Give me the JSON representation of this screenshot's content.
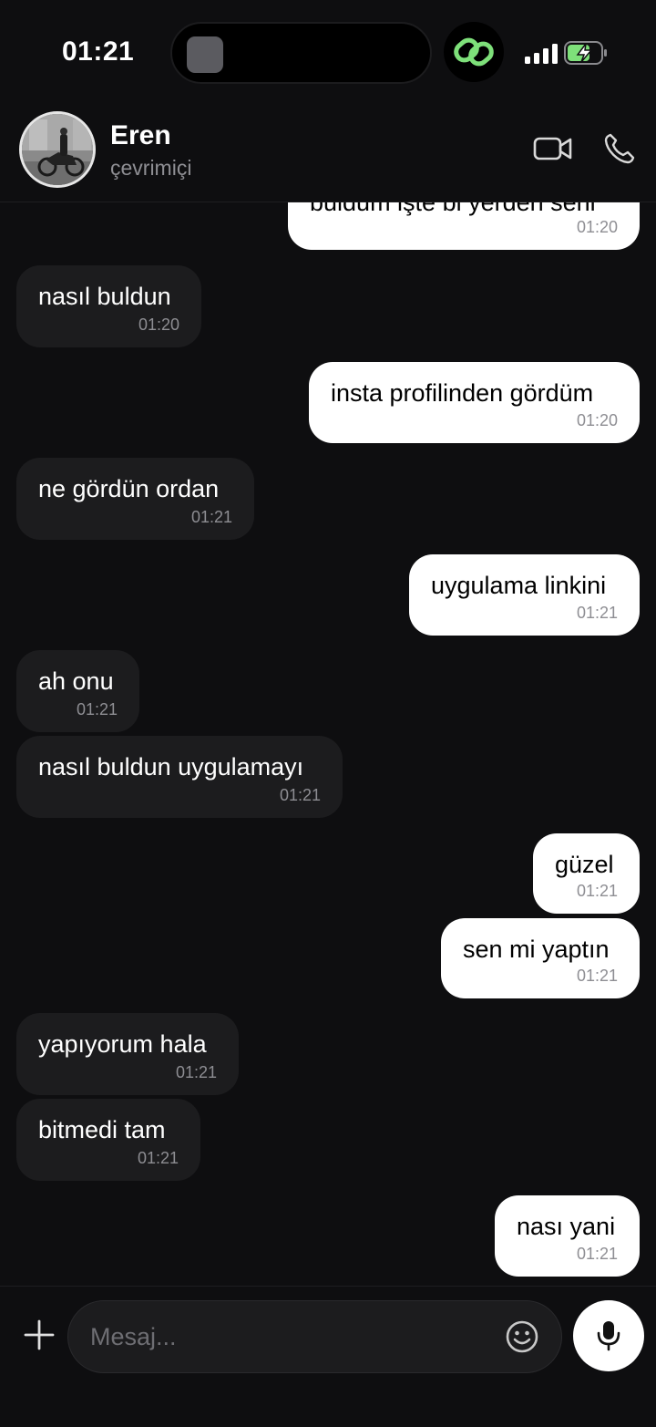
{
  "status_bar": {
    "time": "01:21"
  },
  "header": {
    "contact_name": "Eren",
    "contact_status": "çevrimiçi"
  },
  "messages": [
    {
      "dir": "out",
      "text": "buldum işte bi yerden seni",
      "time": "01:20"
    },
    {
      "dir": "in",
      "text": "nasıl buldun",
      "time": "01:20"
    },
    {
      "dir": "out",
      "text": "insta profilinden gördüm",
      "time": "01:20"
    },
    {
      "dir": "in",
      "text": "ne gördün ordan",
      "time": "01:21"
    },
    {
      "dir": "out",
      "text": "uygulama linkini",
      "time": "01:21"
    },
    {
      "dir": "in",
      "text": "ah onu",
      "time": "01:21"
    },
    {
      "dir": "in",
      "text": "nasıl buldun uygulamayı",
      "time": "01:21"
    },
    {
      "dir": "out",
      "text": "güzel",
      "time": "01:21"
    },
    {
      "dir": "out",
      "text": "sen mi yaptın",
      "time": "01:21"
    },
    {
      "dir": "in",
      "text": "yapıyorum hala",
      "time": "01:21"
    },
    {
      "dir": "in",
      "text": "bitmedi tam",
      "time": "01:21"
    },
    {
      "dir": "out",
      "text": "nası yani",
      "time": "01:21"
    }
  ],
  "composer": {
    "placeholder": "Mesaj..."
  },
  "icons": {
    "video": "video-camera-icon",
    "call": "phone-icon",
    "add": "plus-icon",
    "emoji": "smiley-icon",
    "mic": "microphone-icon"
  },
  "colors": {
    "background": "#0e0e10",
    "incoming_bubble": "#1c1c1e",
    "outgoing_bubble": "#ffffff",
    "accent_green": "#7ee07a"
  }
}
